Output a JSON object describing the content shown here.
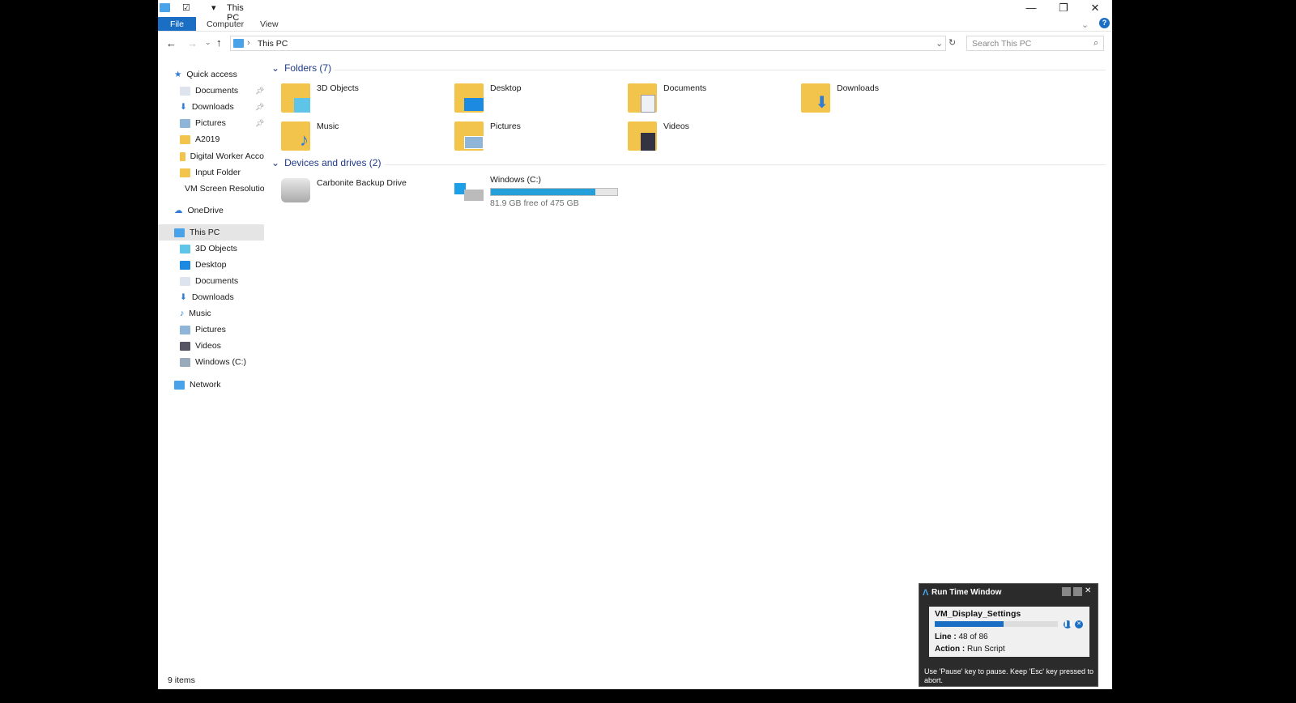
{
  "window": {
    "title": "This PC"
  },
  "ribbon": {
    "tabs": [
      "File",
      "Computer",
      "View"
    ]
  },
  "address": {
    "path": "This PC",
    "search_placeholder": "Search This PC"
  },
  "sidebar": {
    "quick_access": "Quick access",
    "quick_items": [
      "Documents",
      "Downloads",
      "Pictures",
      "A2019",
      "Digital Worker Acco",
      "Input Folder",
      "VM Screen Resolutio"
    ],
    "onedrive": "OneDrive",
    "this_pc": "This PC",
    "pc_items": [
      "3D Objects",
      "Desktop",
      "Documents",
      "Downloads",
      "Music",
      "Pictures",
      "Videos",
      "Windows (C:)"
    ],
    "network": "Network"
  },
  "folders": {
    "header": "Folders (7)",
    "items": [
      "3D Objects",
      "Desktop",
      "Documents",
      "Downloads",
      "Music",
      "Pictures",
      "Videos"
    ]
  },
  "drives": {
    "header": "Devices and drives (2)",
    "items": [
      {
        "name": "Carbonite Backup Drive"
      },
      {
        "name": "Windows (C:)",
        "free": "81.9 GB free of 475 GB",
        "used_percent": 82.8
      }
    ]
  },
  "status": {
    "items": "9 items"
  },
  "runtime": {
    "title": "Run Time Window",
    "task": "VM_Display_Settings",
    "progress_percent": 55.8,
    "line_label": "Line :",
    "line_value": "48 of 86",
    "action_label": "Action :",
    "action_value": "Run Script",
    "hint": "Use 'Pause' key to pause. Keep 'Esc' key pressed to abort."
  },
  "colors": {
    "accent": "#1a6fc4",
    "progress": "#26a0da"
  }
}
